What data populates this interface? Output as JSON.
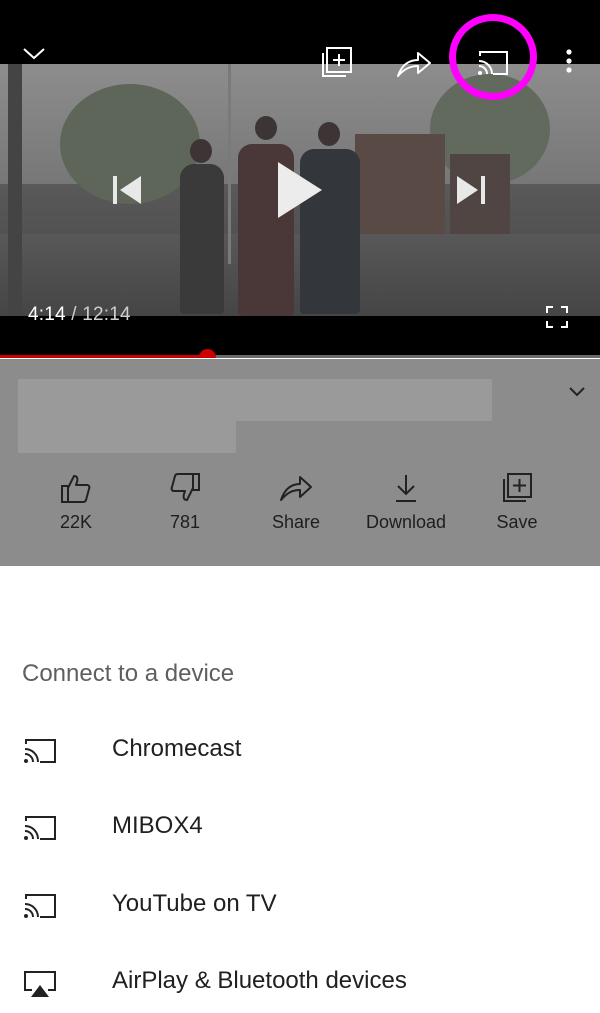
{
  "player": {
    "current_time": "4:14",
    "separator": " / ",
    "duration": "12:14",
    "progress_fraction": 0.345,
    "icons": {
      "minimize": "chevron-down-icon",
      "add_to_playlist": "add-to-playlist-icon",
      "share": "share-icon",
      "cast": "cast-icon",
      "more": "more-vertical-icon",
      "previous": "skip-previous-icon",
      "play": "play-icon",
      "next": "skip-next-icon",
      "fullscreen": "fullscreen-icon"
    },
    "accent_color": "#cc0000",
    "highlight_color": "#ff00ff"
  },
  "actions": [
    {
      "label": "22K",
      "icon": "thumbs-up-icon"
    },
    {
      "label": "781",
      "icon": "thumbs-down-icon"
    },
    {
      "label": "Share",
      "icon": "share-icon"
    },
    {
      "label": "Download",
      "icon": "download-icon"
    },
    {
      "label": "Save",
      "icon": "save-to-playlist-icon"
    }
  ],
  "sheet": {
    "title": "Connect to a device",
    "devices": [
      {
        "label": "Chromecast",
        "icon": "cast-icon"
      },
      {
        "label": "MIBOX4",
        "icon": "cast-icon"
      },
      {
        "label": "YouTube on TV",
        "icon": "cast-icon"
      },
      {
        "label": "AirPlay & Bluetooth devices",
        "icon": "airplay-icon"
      }
    ]
  }
}
